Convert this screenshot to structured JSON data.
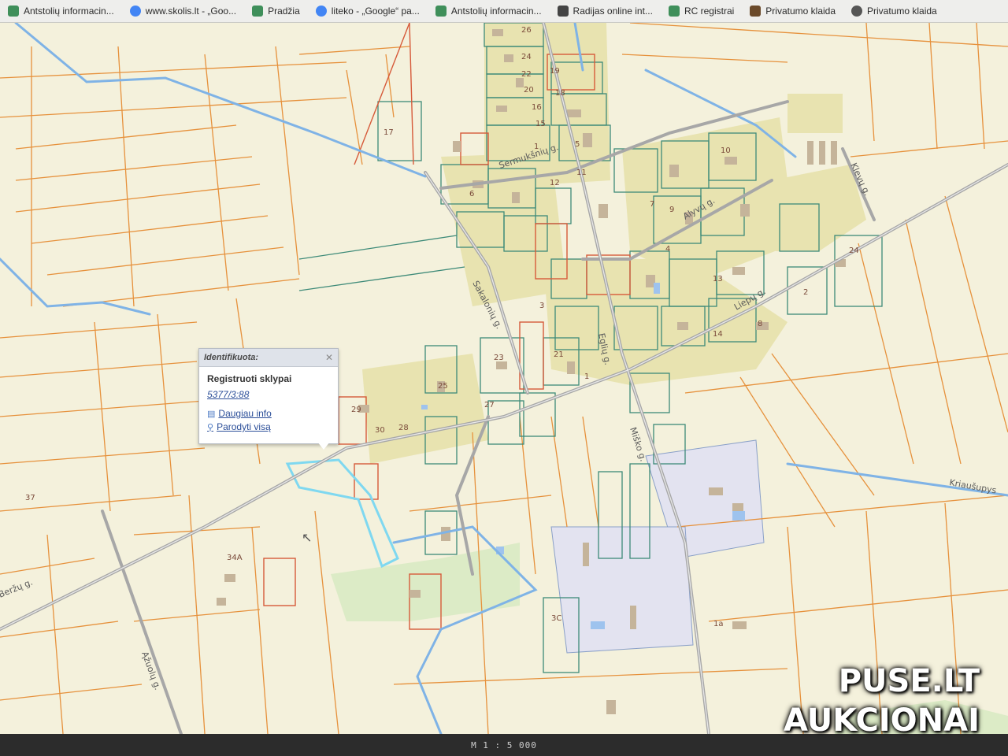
{
  "bookmarks": [
    {
      "label": "Antstolių informacin...",
      "icon": "antstoliai-icon",
      "color": "#3f8f5a"
    },
    {
      "label": "www.skolis.lt - „Goo...",
      "icon": "google-icon",
      "color": "#4285f4"
    },
    {
      "label": "Pradžia",
      "icon": "antstoliai-icon",
      "color": "#3f8f5a"
    },
    {
      "label": "liteko - „Google“ pa...",
      "icon": "google-icon",
      "color": "#4285f4"
    },
    {
      "label": "Antstolių informacin...",
      "icon": "antstoliai-icon",
      "color": "#3f8f5a"
    },
    {
      "label": "Radijas online int...",
      "icon": "radio-icon",
      "color": "#444444"
    },
    {
      "label": "RC registrai",
      "icon": "rc-icon",
      "color": "#3f8f5a"
    },
    {
      "label": "Privatumo klaida",
      "icon": "page-icon",
      "color": "#6b4a2a"
    },
    {
      "label": "Privatumo klaida",
      "icon": "page-icon",
      "color": "#555555"
    }
  ],
  "map": {
    "streets": [
      "Sermukšnių g.",
      "Sakalonių g.",
      "Eglių g.",
      "Alyvų g.",
      "Liepų g.",
      "Klevų g.",
      "Miško g.",
      "Kriaušupys",
      "Ąžuolų g.",
      "Beržų g."
    ],
    "lot_numbers": [
      "26",
      "24",
      "22",
      "20",
      "19",
      "18",
      "17",
      "16",
      "15",
      "14",
      "13",
      "12",
      "11",
      "10",
      "9",
      "8",
      "7",
      "6",
      "5",
      "4",
      "3",
      "2",
      "1",
      "25",
      "23",
      "21",
      "29",
      "28",
      "30",
      "34A",
      "24",
      "37",
      "3C",
      "1a",
      "27",
      "1"
    ],
    "colors": {
      "background": "#f4f1dc",
      "parcel_orange": "#e6913c",
      "parcel_teal": "#3d8a78",
      "parcel_red": "#d65a3a",
      "road": "#a7a7a7",
      "water": "#7fb3e6",
      "highlight": "#7fd8f0",
      "built_area": "#e8e3b0"
    }
  },
  "popup": {
    "title": "Identifikuota:",
    "heading": "Registruoti sklypai",
    "link": "5377/3:88",
    "actions": [
      {
        "label": "Daugiau info",
        "icon": "document-icon"
      },
      {
        "label": "Parodyti visą",
        "icon": "magnifier-icon"
      }
    ]
  },
  "footer": {
    "scale": "M 1 : 5 000"
  },
  "watermark": {
    "line1": "PUSE.LT",
    "line2": "AUKCIONAI"
  }
}
